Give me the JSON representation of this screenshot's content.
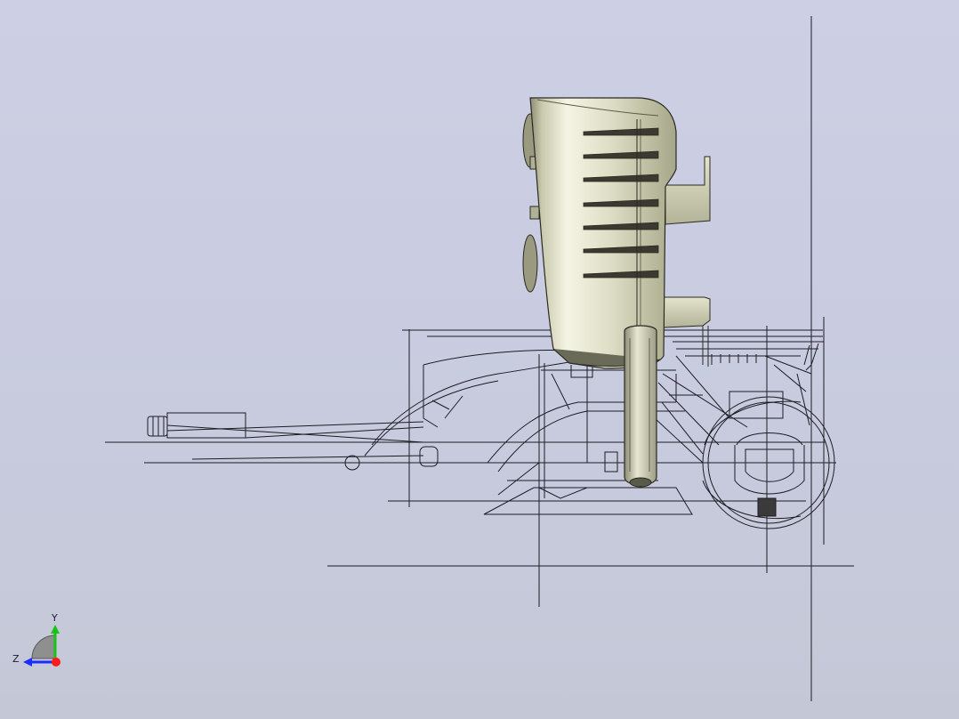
{
  "viewport": {
    "background_top": "#cdcfe4",
    "background_bottom": "#c4c8d6",
    "wire_color": "#1c1c24",
    "shaded_body_color": "#d9d9bf"
  },
  "triad": {
    "y_label": "Y",
    "z_label": "Z",
    "y_color": "#16c316",
    "z_color": "#1a2cff",
    "x_color": "#ff1a1a"
  }
}
